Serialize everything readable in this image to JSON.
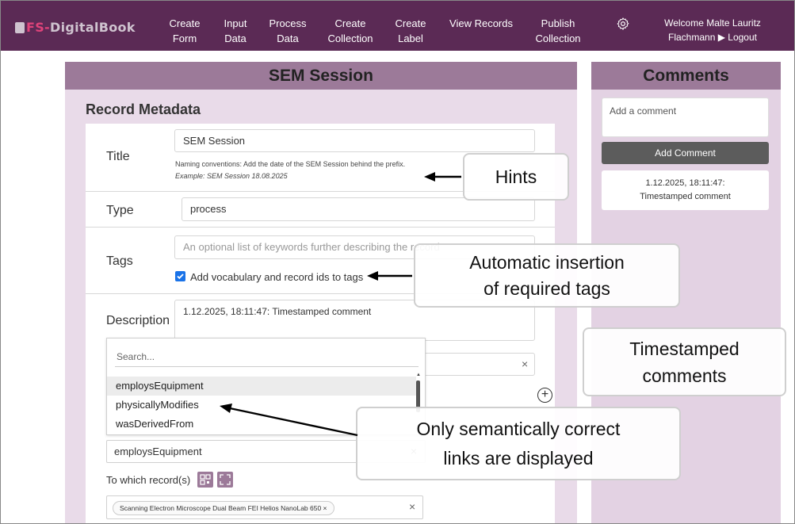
{
  "nav": {
    "logo_prefix": "FS-",
    "logo_rest": "DigitalBook",
    "items": [
      {
        "l1": "Create",
        "l2": "Form"
      },
      {
        "l1": "Input",
        "l2": "Data"
      },
      {
        "l1": "Process",
        "l2": "Data"
      },
      {
        "l1": "Create",
        "l2": "Collection"
      },
      {
        "l1": "Create",
        "l2": "Label"
      },
      {
        "l1": "View Records",
        "l2": ""
      },
      {
        "l1": "Publish",
        "l2": "Collection"
      }
    ],
    "welcome_line1": "Welcome Malte Lauritz",
    "welcome_line2": "Flachmann ▶ Logout"
  },
  "main": {
    "title": "SEM Session",
    "section_title": "Record Metadata",
    "title_label": "Title",
    "title_value": "SEM Session",
    "title_hint": "Naming conventions: Add the date of the SEM Session behind the prefix.",
    "title_example": "Example: SEM Session 18.08.2025",
    "type_label": "Type",
    "type_value": "process",
    "tags_label": "Tags",
    "tags_placeholder": "An optional list of keywords further describing the record",
    "tags_checkbox_label": "Add vocabulary and record ids to tags",
    "description_label": "Description",
    "description_value": "1.12.2025, 18:11:47: Timestamped comment",
    "dropdown": {
      "search_placeholder": "Search...",
      "options": [
        "employsEquipment",
        "physicallyModifies",
        "wasDerivedFrom"
      ],
      "selected_index": 0
    },
    "link_type_value": "employsEquipment",
    "which_records_label": "To which record(s)",
    "record_chip": "Scanning Electron Microscope Dual Beam FEI Helios NanoLab 650 ×"
  },
  "comments": {
    "title": "Comments",
    "placeholder": "Add a comment",
    "button": "Add Comment",
    "entry_line1": "1.12.2025, 18:11:47:",
    "entry_line2": "Timestamped comment"
  },
  "callouts": {
    "hints": "Hints",
    "tags_line1": "Automatic insertion",
    "tags_line2": "of required tags",
    "comments_line1": "Timestamped",
    "comments_line2": "comments",
    "links_line1": "Only semantically correct",
    "links_line2": "links are displayed"
  },
  "colors": {
    "navbar": "#5b2a55",
    "panel_header": "#9c7a99",
    "panel_bg": "#e9dbe9",
    "checkbox": "#1a73e8",
    "button": "#5c5c5c"
  }
}
